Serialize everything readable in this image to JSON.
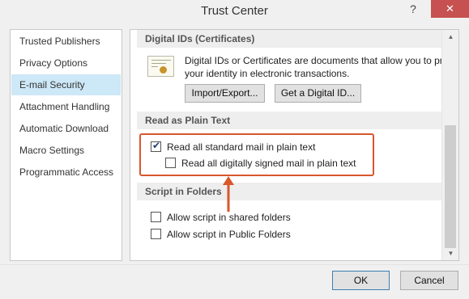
{
  "window": {
    "title": "Trust Center",
    "help_label": "?",
    "close_label": "✕"
  },
  "nav": {
    "items": [
      {
        "label": "Trusted Publishers"
      },
      {
        "label": "Privacy Options"
      },
      {
        "label": "E-mail Security",
        "selected": true
      },
      {
        "label": "Attachment Handling"
      },
      {
        "label": "Automatic Download"
      },
      {
        "label": "Macro Settings"
      },
      {
        "label": "Programmatic Access"
      }
    ]
  },
  "digital_ids": {
    "header": "Digital IDs (Certificates)",
    "desc_line1": "Digital IDs or Certificates are documents that allow you to pro",
    "desc_line2": "your identity in electronic transactions.",
    "import_label": "Import/Export...",
    "get_id_label": "Get a Digital ID..."
  },
  "plain_text": {
    "header": "Read as Plain Text",
    "read_standard_label": "Read all standard mail in plain text",
    "read_standard_checked": true,
    "read_signed_label": "Read all digitally signed mail in plain text",
    "read_signed_checked": false
  },
  "script_folders": {
    "header": "Script in Folders",
    "shared_label": "Allow script in shared folders",
    "shared_checked": false,
    "public_label": "Allow script in Public Folders",
    "public_checked": false
  },
  "footer": {
    "ok_label": "OK",
    "cancel_label": "Cancel"
  },
  "colors": {
    "selected_nav": "#cde8f7",
    "highlight": "#d8572c",
    "close_button": "#c75050"
  }
}
